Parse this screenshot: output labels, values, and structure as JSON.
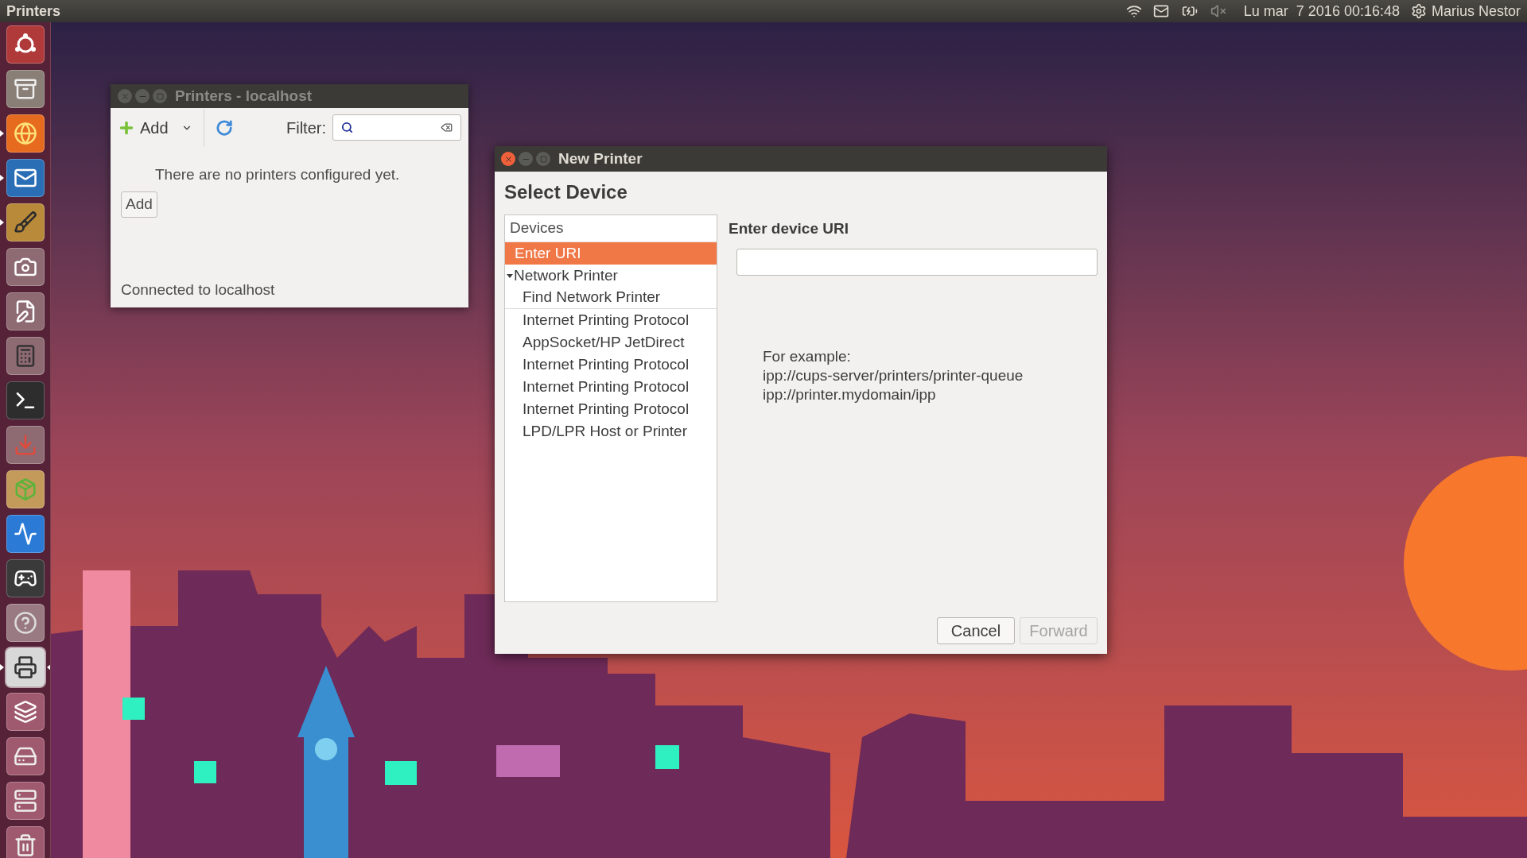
{
  "top_panel": {
    "app_title": "Printers",
    "clock": "Lu mar  7 2016 00:16:48",
    "user": "Marius Nestor"
  },
  "launcher": [
    {
      "kind": "dash",
      "running": false,
      "focused": false
    },
    {
      "kind": "files",
      "running": false,
      "focused": false
    },
    {
      "kind": "browser",
      "running": true,
      "focused": false
    },
    {
      "kind": "mail",
      "running": true,
      "focused": false
    },
    {
      "kind": "paint",
      "running": true,
      "focused": false
    },
    {
      "kind": "camera",
      "running": false,
      "focused": false
    },
    {
      "kind": "editor",
      "running": false,
      "focused": false
    },
    {
      "kind": "calculator",
      "running": false,
      "focused": false
    },
    {
      "kind": "terminal",
      "running": false,
      "focused": false
    },
    {
      "kind": "installer",
      "running": false,
      "focused": false
    },
    {
      "kind": "package",
      "running": false,
      "focused": false
    },
    {
      "kind": "monitor",
      "running": false,
      "focused": false
    },
    {
      "kind": "gaming",
      "running": false,
      "focused": false
    },
    {
      "kind": "help",
      "running": false,
      "focused": false
    },
    {
      "kind": "printer",
      "running": true,
      "focused": true
    },
    {
      "kind": "workspaces",
      "running": false,
      "focused": false
    },
    {
      "kind": "disk",
      "running": false,
      "focused": false
    },
    {
      "kind": "server",
      "running": false,
      "focused": false
    },
    {
      "kind": "trash",
      "running": false,
      "focused": false
    }
  ],
  "printers_window": {
    "title": "Printers - localhost",
    "focused": false,
    "add_label": "Add",
    "filter_label": "Filter:",
    "empty_message": "There are no printers configured yet.",
    "add_button": "Add",
    "status": "Connected to localhost"
  },
  "new_printer_dialog": {
    "title": "New Printer",
    "focused": true,
    "heading": "Select Device",
    "devices_header": "Devices",
    "devices": [
      {
        "label": "Enter URI",
        "selected": true
      },
      {
        "label": "Network Printer",
        "selected": false,
        "expanded": true,
        "children": [
          {
            "label": "Find Network Printer",
            "selected": false,
            "separator_after": true
          },
          {
            "label": "Internet Printing Protocol",
            "selected": false,
            "separator_after": false
          },
          {
            "label": "AppSocket/HP JetDirect",
            "selected": false,
            "separator_after": false
          },
          {
            "label": "Internet Printing Protocol",
            "selected": false,
            "separator_after": false
          },
          {
            "label": "Internet Printing Protocol",
            "selected": false,
            "separator_after": false
          },
          {
            "label": "Internet Printing Protocol",
            "selected": false,
            "separator_after": false
          },
          {
            "label": "LPD/LPR Host or Printer",
            "selected": false,
            "separator_after": false
          }
        ]
      }
    ],
    "uri_label": "Enter device URI",
    "example_lines": [
      "For example:",
      "ipp://cups-server/printers/printer-queue",
      "ipp://printer.mydomain/ipp"
    ],
    "buttons": [
      {
        "label": "Cancel",
        "disabled": false
      },
      {
        "label": "Forward",
        "disabled": true
      }
    ]
  }
}
